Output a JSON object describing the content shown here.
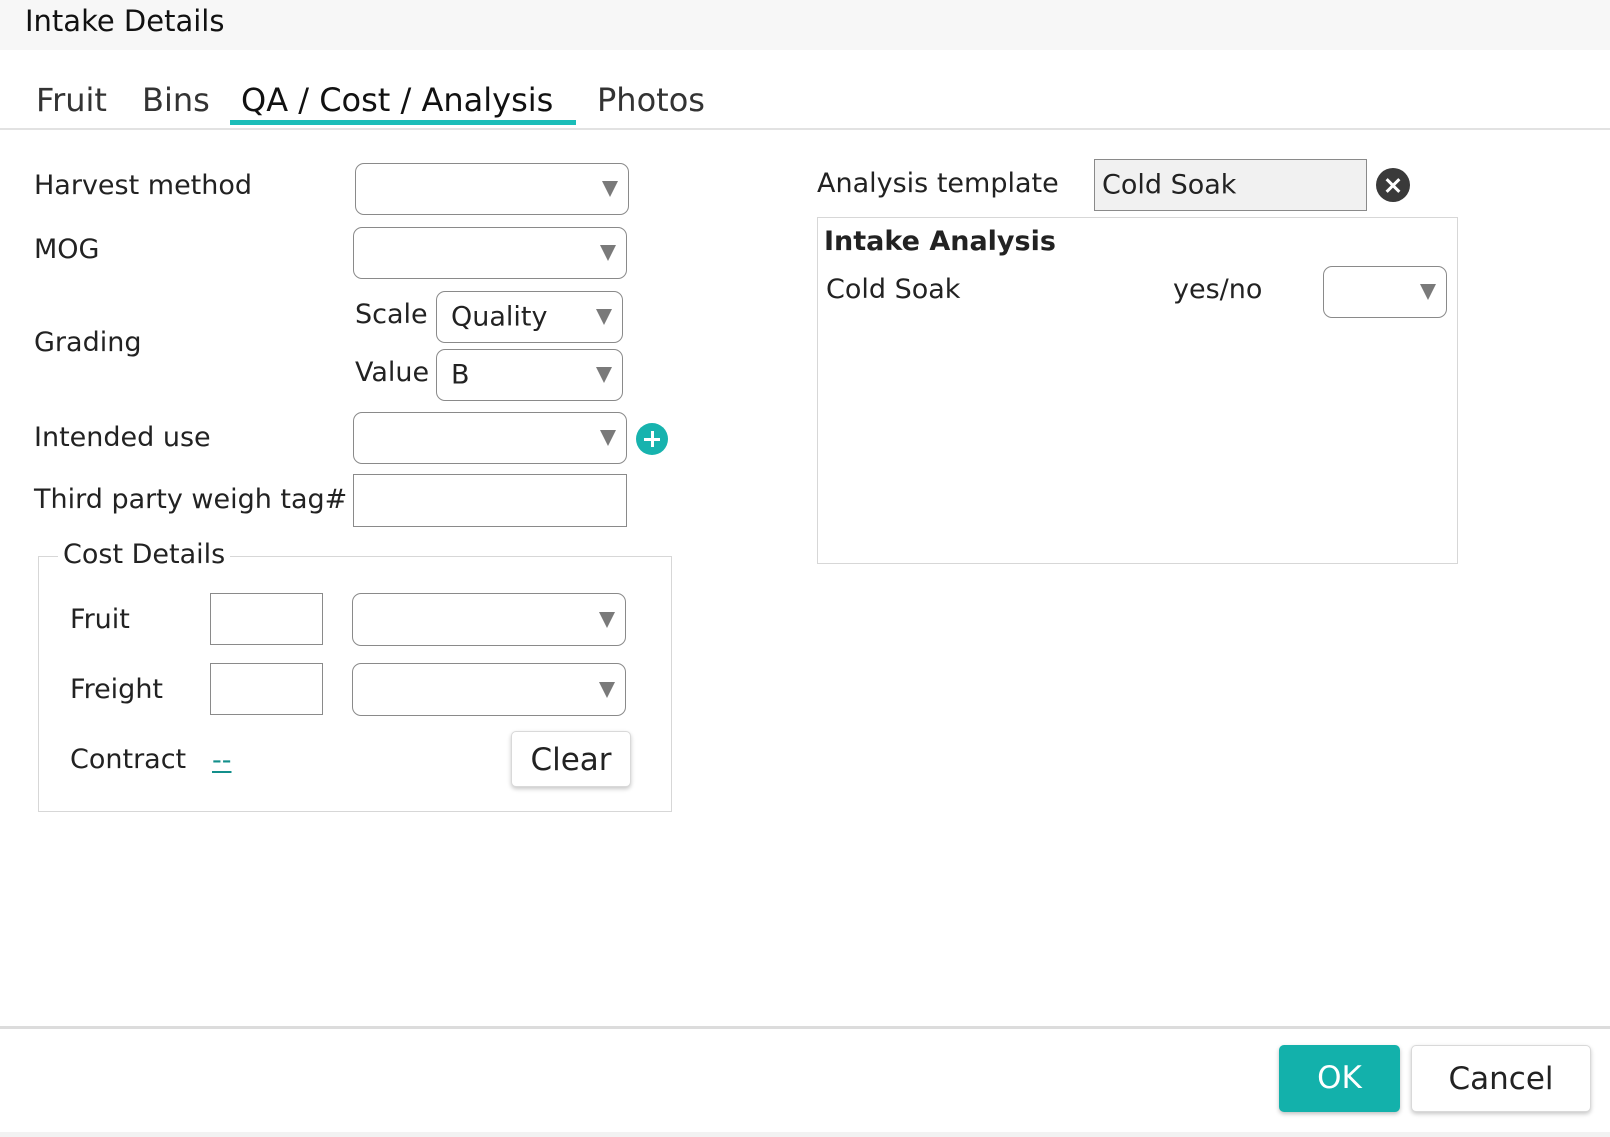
{
  "dialog": {
    "title": "Intake Details"
  },
  "tabs": [
    {
      "label": "Fruit",
      "active": false
    },
    {
      "label": "Bins",
      "active": false
    },
    {
      "label": "QA / Cost / Analysis",
      "active": true
    },
    {
      "label": "Photos",
      "active": false
    }
  ],
  "accent_color": "#1bbdb8",
  "qa": {
    "harvest_method": {
      "label": "Harvest method",
      "value": ""
    },
    "mog": {
      "label": "MOG",
      "value": ""
    },
    "grading": {
      "label": "Grading",
      "scale_label": "Scale",
      "scale_value": "Quality",
      "value_label": "Value",
      "value_value": "B"
    },
    "intended_use": {
      "label": "Intended use",
      "value": "",
      "add_icon": "plus-circle-icon"
    },
    "third_party_weigh_tag": {
      "label": "Third party weigh tag#",
      "value": ""
    }
  },
  "cost_details": {
    "legend": "Cost Details",
    "fruit": {
      "label": "Fruit",
      "amount": "",
      "unit": ""
    },
    "freight": {
      "label": "Freight",
      "amount": "",
      "unit": ""
    },
    "contract": {
      "label": "Contract",
      "link_text": "--"
    },
    "clear_label": "Clear"
  },
  "analysis": {
    "template_label": "Analysis template",
    "template_value": "Cold Soak",
    "clear_icon": "close-circle-icon",
    "panel_title": "Intake Analysis",
    "rows": [
      {
        "name": "Cold Soak",
        "type": "yes/no",
        "value": ""
      }
    ]
  },
  "footer": {
    "ok_label": "OK",
    "cancel_label": "Cancel"
  }
}
